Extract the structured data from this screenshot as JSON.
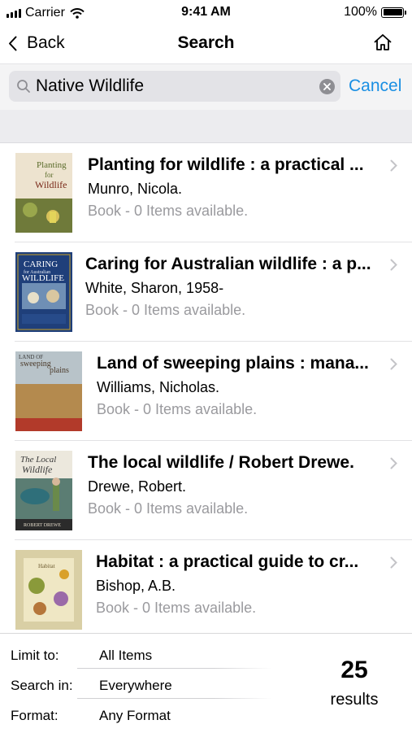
{
  "status": {
    "carrier": "Carrier",
    "time": "9:41 AM",
    "battery_text": "100%",
    "battery_level": 1.0
  },
  "nav": {
    "back_label": "Back",
    "title": "Search"
  },
  "search": {
    "query": "Native Wildlife",
    "cancel_label": "Cancel"
  },
  "results": [
    {
      "title": "Planting for wildlife : a practical ...",
      "author": "Munro, Nicola.",
      "availability": "Book - 0 Items available.",
      "cover": {
        "text1": "Planting",
        "text2": "for",
        "text3": "Wildlife",
        "bg": "#ede3cf",
        "accent": "#5a6b2a"
      }
    },
    {
      "title": "Caring for Australian wildlife : a p...",
      "author": "White, Sharon, 1958-",
      "availability": "Book - 0 Items available.",
      "cover": {
        "text1": "CARING",
        "text2": "for Australian",
        "text3": "WILDLIFE",
        "bg": "#1f3f7a",
        "accent": "#c9a227"
      }
    },
    {
      "title": "Land of sweeping plains : mana...",
      "author": "Williams, Nicholas.",
      "availability": "Book - 0 Items available.",
      "cover": {
        "text1": "LAND OF",
        "text2": "sweeping",
        "text3": "plains",
        "bg": "#b9a06a",
        "accent": "#8a5a2b"
      }
    },
    {
      "title": "The local wildlife / Robert Drewe.",
      "author": "Drewe, Robert.",
      "availability": "Book - 0 Items available.",
      "cover": {
        "text1": "The Local",
        "text2": "Wildlife",
        "text3": "ROBERT DREWE",
        "bg": "#ece8dd",
        "accent": "#2f6f7a"
      }
    },
    {
      "title": "Habitat : a practical guide to cr...",
      "author": "Bishop, A.B.",
      "availability": "Book - 0 Items available.",
      "cover": {
        "text1": "Habitat",
        "text2": "",
        "text3": "",
        "bg": "#d9cfa5",
        "accent": "#6c7c2f"
      }
    }
  ],
  "filters": [
    {
      "label": "Limit to:",
      "value": "All Items"
    },
    {
      "label": "Search in:",
      "value": "Everywhere"
    },
    {
      "label": "Format:",
      "value": "Any Format"
    }
  ],
  "summary": {
    "count": "25",
    "count_label": "results"
  },
  "colors": {
    "accent": "#1a8fe3",
    "muted": "#9a9a9e",
    "search_bg": "#f4f4f5"
  }
}
